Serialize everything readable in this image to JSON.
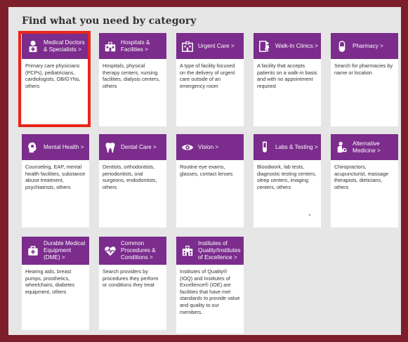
{
  "title": "Find what you need by category",
  "colors": {
    "header": "#7b2c8c",
    "highlight": "#e8261b",
    "frame": "#7d1f2b"
  },
  "cards": [
    {
      "icon": "doctor-icon",
      "label": "Medical Doctors & Specialists >",
      "desc": "Primary care physicians (PCPs), pediatricians, cardiologists, OB/GYNs, others"
    },
    {
      "icon": "hospital-icon",
      "label": "Hospitals & Facilities >",
      "desc": "Hospitals, physical therapy centers, nursing facilities, dialysis centers, others"
    },
    {
      "icon": "urgent-care-icon",
      "label": "Urgent Care >",
      "desc": "A type of facility focused on the delivery of urgent care outside of an emergency room"
    },
    {
      "icon": "walk-in-clinic-icon",
      "label": "Walk-In Clinics >",
      "desc": "A facility that accepts patients on a walk-in basis and with no appointment required"
    },
    {
      "icon": "pharmacy-icon",
      "label": "Pharmacy >",
      "desc": "Search for pharmacies by name or location"
    },
    {
      "icon": "mental-health-icon",
      "label": "Mental Health >",
      "desc": "Counseling, EAP, mental health facilities, substance abuse treatment, psychiatrists, others"
    },
    {
      "icon": "tooth-icon",
      "label": "Dental Care >",
      "desc": "Dentists, orthodontists, periodontists, oral surgeons, endodontists, others"
    },
    {
      "icon": "eye-icon",
      "label": "Vision >",
      "desc": "Routine eye exams, glasses, contact lenses"
    },
    {
      "icon": "test-tube-icon",
      "label": "Labs & Testing >",
      "desc": "Bloodwork, lab tests, diagnostic testing centers, sleep centers, imaging centers, others"
    },
    {
      "icon": "alternative-medicine-icon",
      "label": "Alternative Medicine >",
      "desc": "Chiropractors, acupuncturist, massage therapists, dieticians, others"
    },
    {
      "icon": "medical-bag-icon",
      "label": "Durable Medical Equipment (DME) >",
      "desc": "Hearing aids, breast pumps, prosthetics, wheelchairs, diabetes equipment, others"
    },
    {
      "icon": "heart-pulse-icon",
      "label": "Common Procedures & Conditions >",
      "desc": "Search providers by procedures they perform or conditions they treat"
    },
    {
      "icon": "institute-icon",
      "label": "Institutes of Quality/Institutes of Excellence >",
      "desc": "Institutes of Quality® (IOQ) and Institutes of Excellence® (IOE) are facilities that have met standards to provide value and quality to our members."
    }
  ]
}
